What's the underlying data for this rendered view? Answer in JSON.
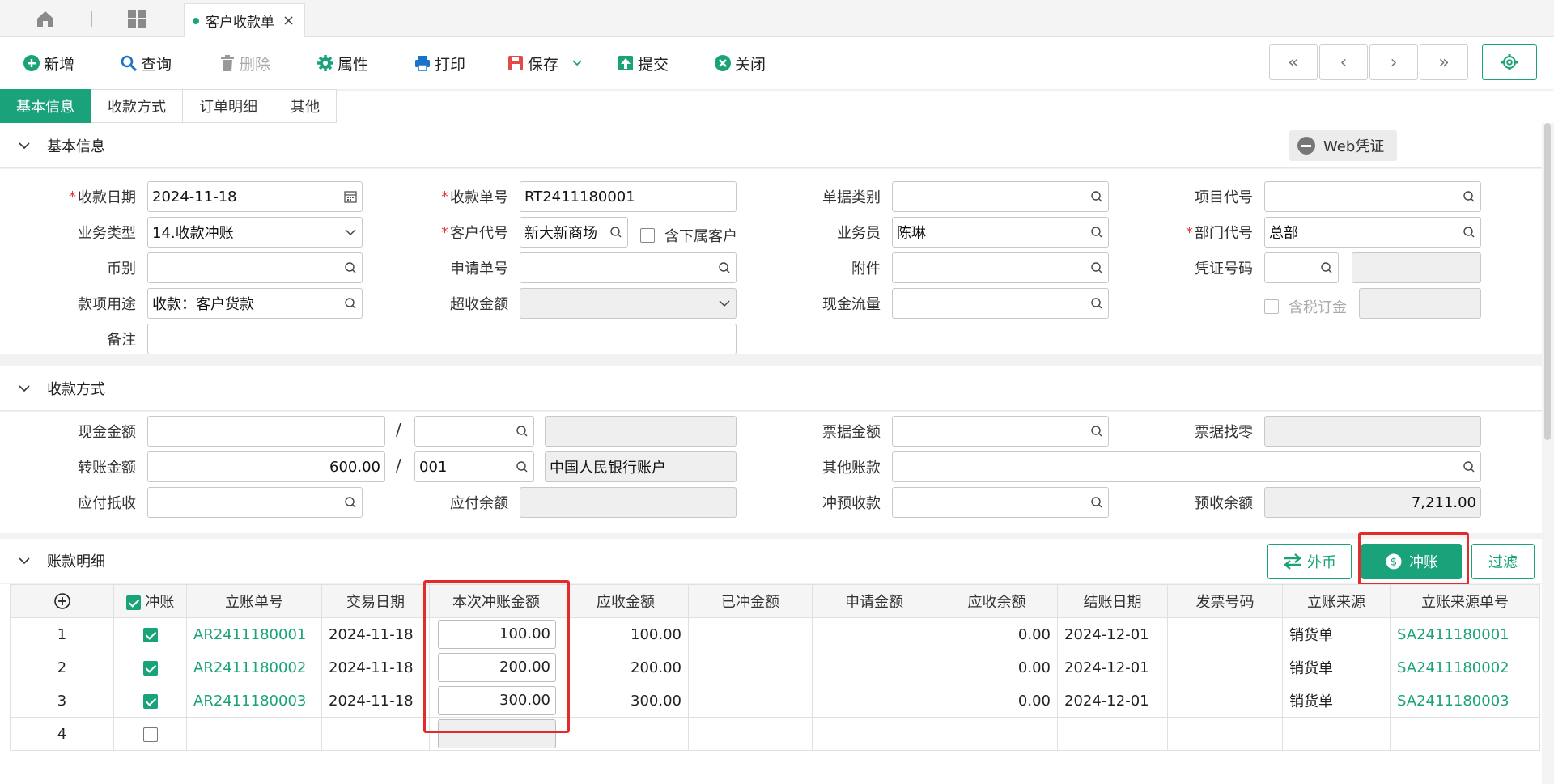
{
  "tabs": {
    "doc_title": "客户收款单"
  },
  "toolbar": {
    "new": "新增",
    "query": "查询",
    "delete": "删除",
    "props": "属性",
    "print": "打印",
    "save": "保存",
    "submit": "提交",
    "close": "关闭",
    "nav": [
      "«",
      "‹",
      "›",
      "»"
    ]
  },
  "subtabs": [
    "基本信息",
    "收款方式",
    "订单明细",
    "其他"
  ],
  "basic": {
    "title": "基本信息",
    "web_voucher": "Web凭证",
    "date_label": "收款日期",
    "date_value": "2024-11-18",
    "no_label": "收款单号",
    "no_value": "RT2411180001",
    "bill_type_label": "单据类别",
    "bill_type_value": "",
    "project_label": "项目代号",
    "project_value": "",
    "biz_type_label": "业务类型",
    "biz_type_value": "14.收款冲账",
    "cust_label": "客户代号",
    "cust_value": "新大新商场",
    "sub_cust_label": "含下属客户",
    "sales_label": "业务员",
    "sales_value": "陈琳",
    "dept_label": "部门代号",
    "dept_value": "总部",
    "currency_label": "币别",
    "currency_value": "",
    "apply_no_label": "申请单号",
    "apply_no_value": "",
    "attach_label": "附件",
    "attach_value": "",
    "voucher_label": "凭证号码",
    "voucher_value": "",
    "usage_label": "款项用途",
    "usage_value": "收款：客户货款",
    "over_label": "超收金额",
    "over_value": "",
    "cashflow_label": "现金流量",
    "cashflow_value": "",
    "tax_order_label": "含税订金",
    "remark_label": "备注",
    "remark_value": ""
  },
  "payment": {
    "title": "收款方式",
    "cash_label": "现金金额",
    "cash_value": "",
    "cash_acct": "",
    "cash_acct_name": "",
    "bill_amt_label": "票据金额",
    "bill_amt_value": "",
    "bill_change_label": "票据找零",
    "bill_change_value": "",
    "transfer_label": "转账金额",
    "transfer_value": "600.00",
    "transfer_acct": "001",
    "transfer_acct_name": "中国人民银行账户",
    "other_label": "其他账款",
    "other_value": "",
    "payable_offset_label": "应付抵收",
    "payable_offset_value": "",
    "payable_bal_label": "应付余额",
    "payable_bal_value": "",
    "prepay_offset_label": "冲预收款",
    "prepay_offset_value": "",
    "prepay_bal_label": "预收余额",
    "prepay_bal_value": "7,211.00"
  },
  "detail": {
    "title": "账款明细",
    "btn_fx": "外币",
    "btn_offset": "冲账",
    "btn_filter": "过滤",
    "columns": [
      "冲账",
      "立账单号",
      "交易日期",
      "本次冲账金额",
      "应收金额",
      "已冲金额",
      "申请金额",
      "应收余额",
      "结账日期",
      "发票号码",
      "立账来源",
      "立账来源单号"
    ],
    "rows": [
      {
        "idx": "1",
        "no": "AR2411180001",
        "date": "2024-11-18",
        "offset": "100.00",
        "recv": "100.00",
        "done": "",
        "apply": "",
        "bal": "0.00",
        "close": "2024-12-01",
        "inv": "",
        "src": "销货单",
        "src_no": "SA2411180001"
      },
      {
        "idx": "2",
        "no": "AR2411180002",
        "date": "2024-11-18",
        "offset": "200.00",
        "recv": "200.00",
        "done": "",
        "apply": "",
        "bal": "0.00",
        "close": "2024-12-01",
        "inv": "",
        "src": "销货单",
        "src_no": "SA2411180002"
      },
      {
        "idx": "3",
        "no": "AR2411180003",
        "date": "2024-11-18",
        "offset": "300.00",
        "recv": "300.00",
        "done": "",
        "apply": "",
        "bal": "0.00",
        "close": "2024-12-01",
        "inv": "",
        "src": "销货单",
        "src_no": "SA2411180003"
      },
      {
        "idx": "4",
        "no": "",
        "date": "",
        "offset": "",
        "recv": "",
        "done": "",
        "apply": "",
        "bal": "",
        "close": "",
        "inv": "",
        "src": "",
        "src_no": ""
      }
    ]
  },
  "colors": {
    "accent": "#1aa37a",
    "highlight": "#e32b2b"
  }
}
